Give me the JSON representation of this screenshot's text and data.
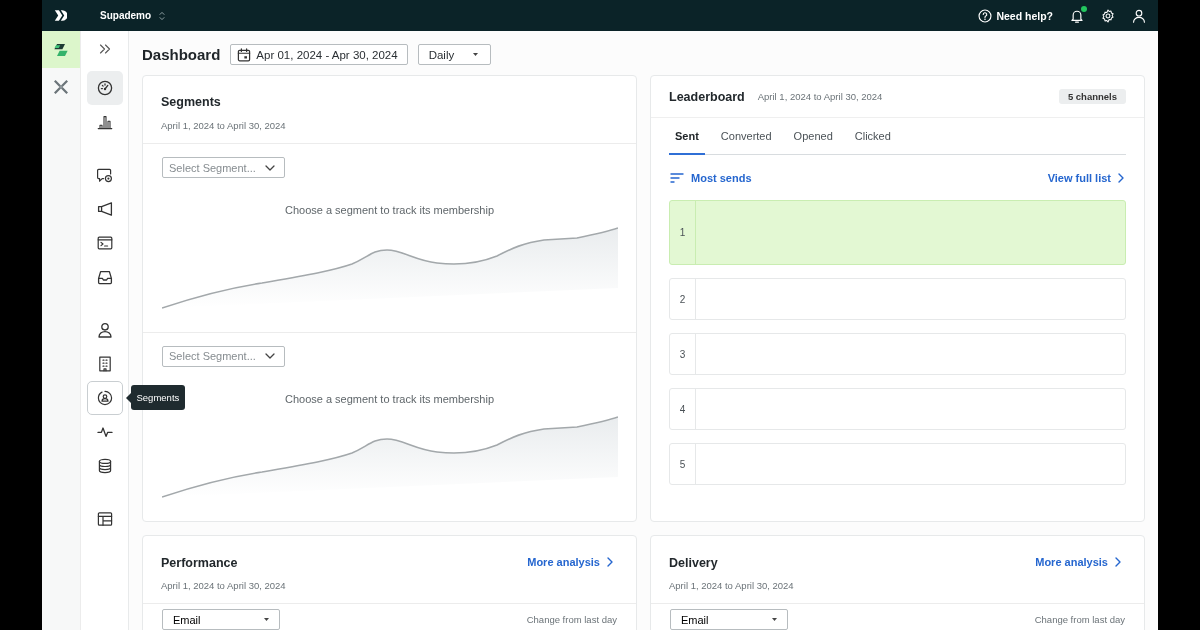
{
  "topbar": {
    "workspace": "Supademo",
    "help": "Need help?",
    "notifications": {
      "unread": true
    }
  },
  "app_rail": [
    {
      "kind": "tiles",
      "selected": true
    },
    {
      "kind": "cross",
      "selected": false
    }
  ],
  "sidebar": {
    "groups": [
      {
        "items": [
          {
            "kind": "gauge",
            "selected": true,
            "hovered": false
          },
          {
            "kind": "bars",
            "selected": false,
            "hovered": false
          }
        ]
      },
      {
        "items": [
          {
            "kind": "chat",
            "selected": false,
            "hovered": false
          },
          {
            "kind": "megaphone",
            "selected": false,
            "hovered": false
          },
          {
            "kind": "terminal",
            "selected": false,
            "hovered": false
          },
          {
            "kind": "inbox",
            "selected": false,
            "hovered": false
          }
        ]
      },
      {
        "items": [
          {
            "kind": "person",
            "selected": false,
            "hovered": false
          },
          {
            "kind": "building",
            "selected": false,
            "hovered": false
          },
          {
            "kind": "segment",
            "selected": false,
            "hovered": true,
            "tooltip": "Segments"
          },
          {
            "kind": "pulse",
            "selected": false,
            "hovered": false
          },
          {
            "kind": "database",
            "selected": false,
            "hovered": false
          }
        ]
      },
      {
        "items": [
          {
            "kind": "table",
            "selected": false,
            "hovered": false
          }
        ]
      }
    ]
  },
  "header": {
    "title": "Dashboard",
    "date_range": "Apr 01, 2024 - Apr 30, 2024",
    "interval": "Daily"
  },
  "segments": {
    "title": "Segments",
    "subtitle": "April 1, 2024 to April 30, 2024",
    "panels": [
      {
        "placeholder": "Select Segment...",
        "message": "Choose a segment to track its membership"
      },
      {
        "placeholder": "Select Segment...",
        "message": "Choose a segment to track its membership"
      }
    ]
  },
  "leaderboard": {
    "title": "Leaderboard",
    "subtitle": "April 1, 2024 to April 30, 2024",
    "badge": "5 channels",
    "tabs": [
      {
        "label": "Sent",
        "selected": true
      },
      {
        "label": "Converted",
        "selected": false
      },
      {
        "label": "Opened",
        "selected": false
      },
      {
        "label": "Clicked",
        "selected": false
      }
    ],
    "sort": "Most sends",
    "link": "View full list",
    "rows": [
      {
        "rank": "1",
        "selected": true
      },
      {
        "rank": "2",
        "selected": false
      },
      {
        "rank": "3",
        "selected": false
      },
      {
        "rank": "4",
        "selected": false
      },
      {
        "rank": "5",
        "selected": false
      }
    ]
  },
  "reports": [
    {
      "title": "Performance",
      "link": "More analysis",
      "subtitle": "April 1, 2024 to April 30, 2024",
      "filter": "Email",
      "note": "Change from last day"
    },
    {
      "title": "Delivery",
      "link": "More analysis",
      "subtitle": "April 1, 2024 to April 30, 2024",
      "filter": "Email",
      "note": "Change from last day"
    }
  ]
}
